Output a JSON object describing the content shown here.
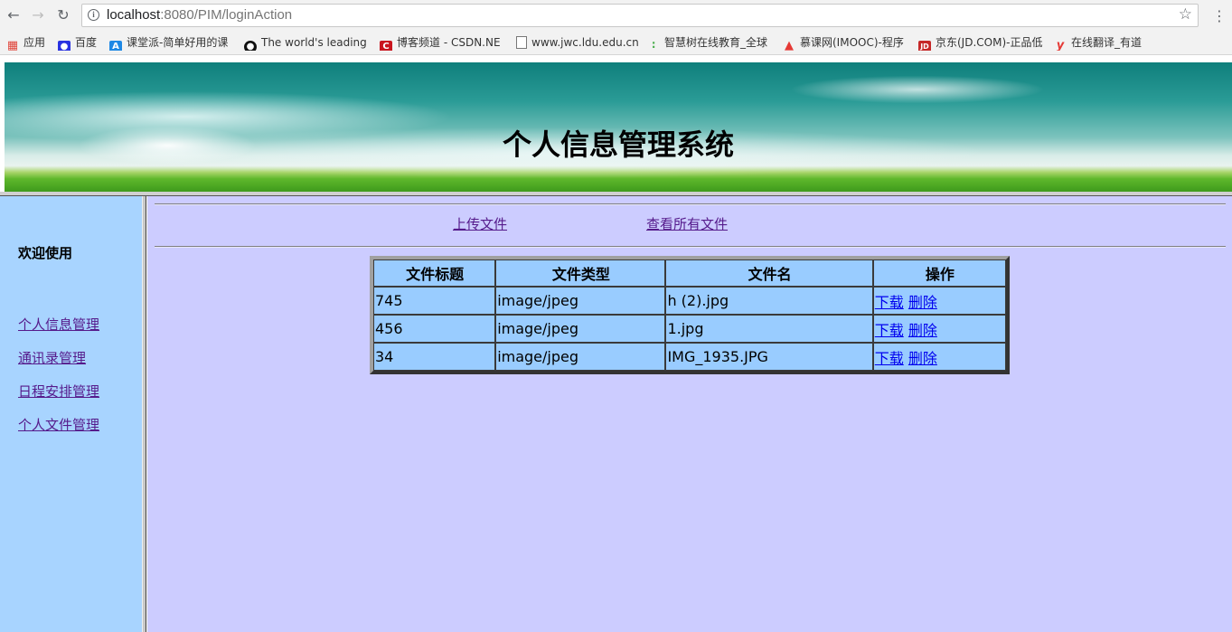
{
  "browser": {
    "url_host": "localhost",
    "url_path": ":8080/PIM/loginAction",
    "bookmarks": [
      {
        "label": "应用",
        "icon": "apps-grid-icon",
        "color": "#e0443a"
      },
      {
        "label": "百度",
        "icon": "baidu-paw-icon",
        "color": "#2932e1"
      },
      {
        "label": "课堂派-简单好用的课",
        "icon": "ketangpai-icon",
        "color": "#1e88e5"
      },
      {
        "label": "The world's leading",
        "icon": "github-icon",
        "color": "#111111"
      },
      {
        "label": "博客频道 - CSDN.NE",
        "icon": "csdn-icon",
        "color": "#c9151e"
      },
      {
        "label": "www.jwc.ldu.edu.cn",
        "icon": "page-icon",
        "color": "#777777"
      },
      {
        "label": "智慧树在线教育_全球",
        "icon": "zhihuishu-icon",
        "color": "#4caf50"
      },
      {
        "label": "慕课网(IMOOC)-程序",
        "icon": "imooc-flame-icon",
        "color": "#e53935"
      },
      {
        "label": "京东(JD.COM)-正品低",
        "icon": "jd-icon",
        "color": "#c62828"
      },
      {
        "label": "在线翻译_有道",
        "icon": "youdao-icon",
        "color": "#e53935"
      }
    ]
  },
  "header": {
    "title": "个人信息管理系统"
  },
  "sidebar": {
    "welcome": "欢迎使用",
    "items": [
      {
        "label": "个人信息管理"
      },
      {
        "label": "通讯录管理"
      },
      {
        "label": "日程安排管理"
      },
      {
        "label": "个人文件管理"
      }
    ]
  },
  "main": {
    "upload_link": "上传文件",
    "view_all_link": "查看所有文件",
    "table": {
      "headers": [
        "文件标题",
        "文件类型",
        "文件名",
        "操作"
      ],
      "rows": [
        {
          "title": "745",
          "type": "image/jpeg",
          "filename": "h (2).jpg",
          "download": "下载",
          "delete": "删除"
        },
        {
          "title": "456",
          "type": "image/jpeg",
          "filename": "1.jpg",
          "download": "下载",
          "delete": "删除"
        },
        {
          "title": "34",
          "type": "image/jpeg",
          "filename": "IMG_1935.JPG",
          "download": "下载",
          "delete": "删除"
        }
      ]
    }
  },
  "colors": {
    "sidebar_bg": "#a8d4ff",
    "main_bg": "#ccccff",
    "table_cell_bg": "#99ccff",
    "visited_link": "#551a8b",
    "link": "#0000ee"
  }
}
